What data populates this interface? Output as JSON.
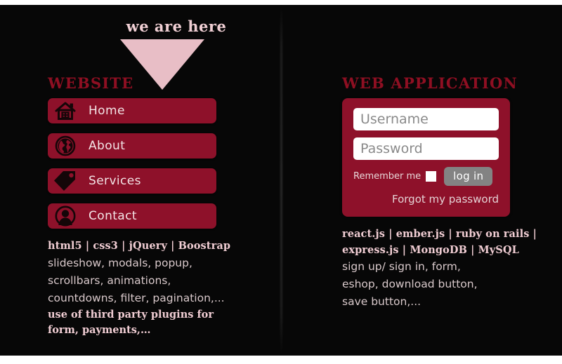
{
  "marker": {
    "label": "we are here",
    "triangle_color": "#e8bec6"
  },
  "theme": {
    "background": "#070707",
    "panel_red": "#8e112a",
    "heading_red": "#8e0f22",
    "pink_text": "#f0cdd3",
    "grey_text": "#d9c9cb",
    "button_grey": "#838383"
  },
  "website": {
    "heading": "WEBSITE",
    "nav": [
      {
        "label": "Home",
        "icon": "house-icon"
      },
      {
        "label": "About",
        "icon": "globe-icon"
      },
      {
        "label": "Services",
        "icon": "price-tag-icon"
      },
      {
        "label": "Contact",
        "icon": "person-icon"
      }
    ],
    "tech_stack": "html5 | css3 | jQuery | Boostrap",
    "features": [
      "slideshow, modals, popup,",
      "scrollbars, animations,",
      "countdowns, filter, pagination,..."
    ],
    "note": [
      "use of third party plugins for",
      "form, payments,…"
    ]
  },
  "webapp": {
    "heading": "WEB APPLICATION",
    "login": {
      "username_placeholder": "Username",
      "username_value": "",
      "password_placeholder": "Password",
      "password_value": "",
      "remember_label": "Remember me",
      "remember_checked": false,
      "login_button": "log in",
      "forgot_link": "Forgot my password"
    },
    "tech_stack": [
      "react.js | ember.js | ruby on rails |",
      "express.js |  MongoDB | MySQL"
    ],
    "features": [
      "sign up/ sign in, form,",
      "eshop, download button,",
      "save button,..."
    ]
  }
}
